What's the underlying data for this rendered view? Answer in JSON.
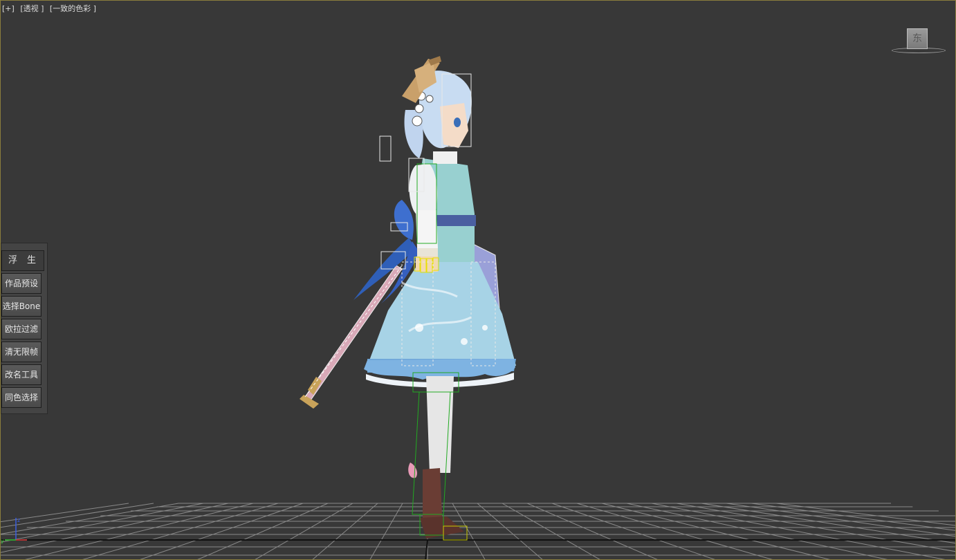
{
  "viewport": {
    "labels": [
      "[+]",
      "[透视 ]",
      "[一致的色彩 ]"
    ],
    "viewcube_face": "东",
    "frame_color": "#8a7d3c",
    "background_color": "#383838"
  },
  "float_panel": {
    "title_chars": [
      "浮",
      "生"
    ],
    "buttons": [
      "作品预设",
      "选择Bone",
      "欧拉过滤",
      "清无限帧",
      "改名工具",
      "同色选择"
    ]
  },
  "scene": {
    "model": "anime-girl-character-side-view",
    "axis_labels": {
      "x": "x",
      "y": "y",
      "z": "z"
    },
    "colors": {
      "grid_line": "#8a8a8a",
      "dress": "#8ec0dc",
      "bone_wire": "#22aa22",
      "selection_wire": "#e8e8e8"
    }
  }
}
